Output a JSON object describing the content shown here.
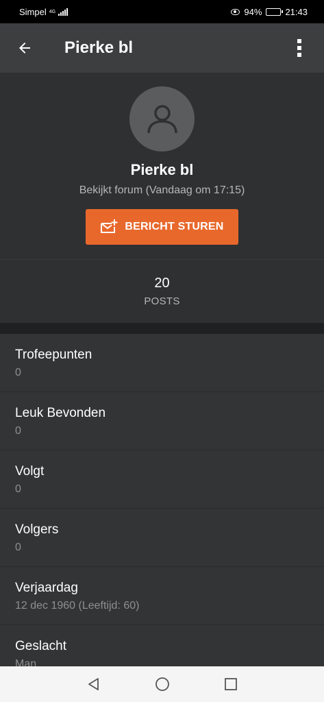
{
  "status_bar": {
    "carrier": "Simpel",
    "network": "4G",
    "battery": "94%",
    "battery_level": 0.94,
    "time": "21:43"
  },
  "app_bar": {
    "title": "Pierke bl",
    "back_icon": "arrow-left-icon",
    "menu_icon": "more-vertical-icon"
  },
  "profile": {
    "avatar_icon": "user-icon",
    "name": "Pierke bl",
    "last_seen": "Bekijkt forum (Vandaag om 17:15)",
    "message_button": "BERICHT STUREN",
    "message_icon": "mail-plus-icon",
    "accent_color": "#e8682c"
  },
  "stats": {
    "posts_value": "20",
    "posts_label": "POSTS"
  },
  "details": [
    {
      "label": "Trofeepunten",
      "value": "0"
    },
    {
      "label": "Leuk Bevonden",
      "value": "0"
    },
    {
      "label": "Volgt",
      "value": "0"
    },
    {
      "label": "Volgers",
      "value": "0"
    },
    {
      "label": "Verjaardag",
      "value": "12 dec 1960 (Leeftijd: 60)"
    },
    {
      "label": "Geslacht",
      "value": "Man"
    }
  ],
  "nav_bar": {
    "back_icon": "triangle-back-icon",
    "home_icon": "circle-home-icon",
    "recents_icon": "square-recents-icon"
  }
}
